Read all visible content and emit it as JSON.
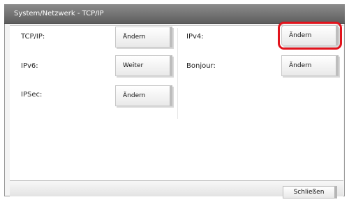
{
  "window": {
    "title": "System/Netzwerk - TCP/IP"
  },
  "settings": [
    {
      "label": "TCP/IP:",
      "button": "Ändern"
    },
    {
      "label": "IPv4:",
      "button": "Ändern",
      "highlighted": true
    },
    {
      "label": "IPv6:",
      "button": "Weiter"
    },
    {
      "label": "Bonjour:",
      "button": "Ändern"
    },
    {
      "label": "IPSec:",
      "button": "Ändern"
    }
  ],
  "footer": {
    "close_label": "Schließen"
  },
  "colors": {
    "highlight": "#e2131c"
  }
}
